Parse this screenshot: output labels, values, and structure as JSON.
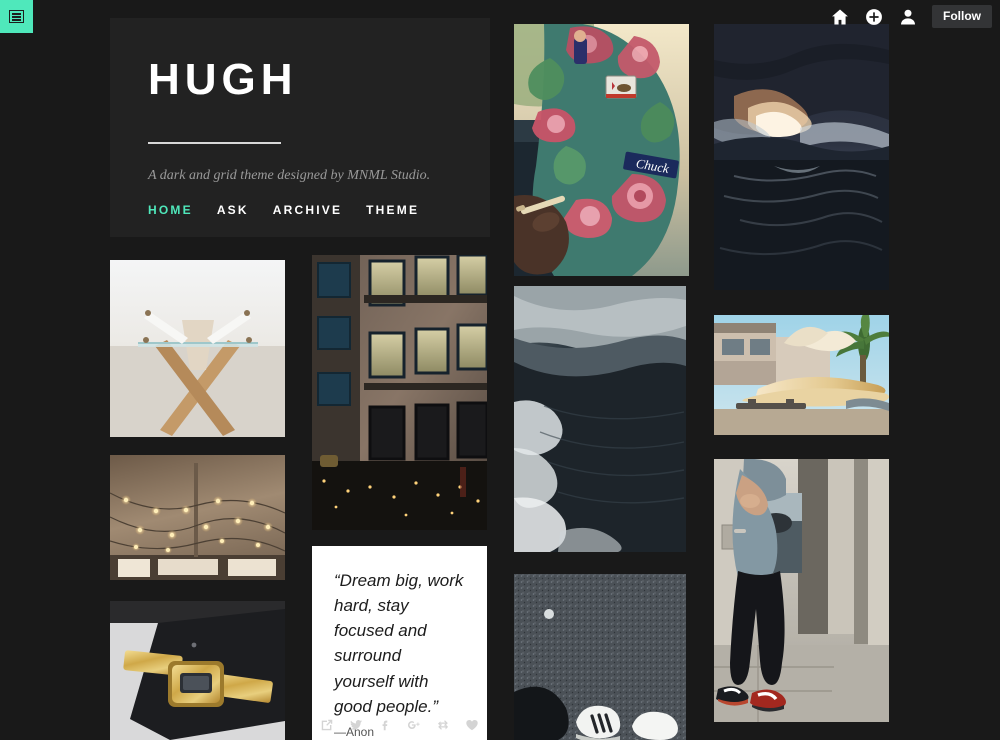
{
  "topbar": {
    "menu_icon": "hamburger-menu-icon",
    "menu_color": "#4fe8bb",
    "icons": [
      {
        "name": "home-icon"
      },
      {
        "name": "create-post-icon"
      },
      {
        "name": "account-avatar-icon"
      }
    ],
    "follow_label": "Follow"
  },
  "header": {
    "title": "HUGH",
    "description": "A dark and grid theme designed by MNML Studio.",
    "nav": [
      {
        "label": "Home",
        "active": true
      },
      {
        "label": "Ask",
        "active": false
      },
      {
        "label": "Archive",
        "active": false
      },
      {
        "label": "Theme",
        "active": false
      }
    ],
    "accent_color": "#4fe8bb",
    "panel_color": "#222222"
  },
  "page": {
    "background_color": "#191919"
  },
  "grid": {
    "posts": [
      {
        "name": "post-glass-wood-table",
        "kind": "photo"
      },
      {
        "name": "post-string-lights-ceiling",
        "kind": "photo"
      },
      {
        "name": "post-gold-watch-on-phone",
        "kind": "photo"
      },
      {
        "name": "post-brick-building-facade",
        "kind": "photo"
      },
      {
        "name": "post-quote-dream-big",
        "kind": "quote"
      },
      {
        "name": "post-floral-bucket-hat",
        "kind": "photo"
      },
      {
        "name": "post-dark-ocean-wave",
        "kind": "photo"
      },
      {
        "name": "post-sneakers-on-asphalt",
        "kind": "photo"
      },
      {
        "name": "post-stormy-sunset-lake",
        "kind": "photo"
      },
      {
        "name": "post-surfboards-on-car",
        "kind": "photo"
      },
      {
        "name": "post-street-portrait-red-sneakers",
        "kind": "photo"
      }
    ]
  },
  "quote": {
    "text": "“Dream big, work hard, stay focused and surround yourself with good people.”",
    "source": "—Anon",
    "actions": [
      {
        "name": "share-external-icon"
      },
      {
        "name": "twitter-icon"
      },
      {
        "name": "facebook-icon"
      },
      {
        "name": "google-plus-icon"
      },
      {
        "name": "reblog-icon"
      },
      {
        "name": "like-heart-icon"
      }
    ]
  }
}
